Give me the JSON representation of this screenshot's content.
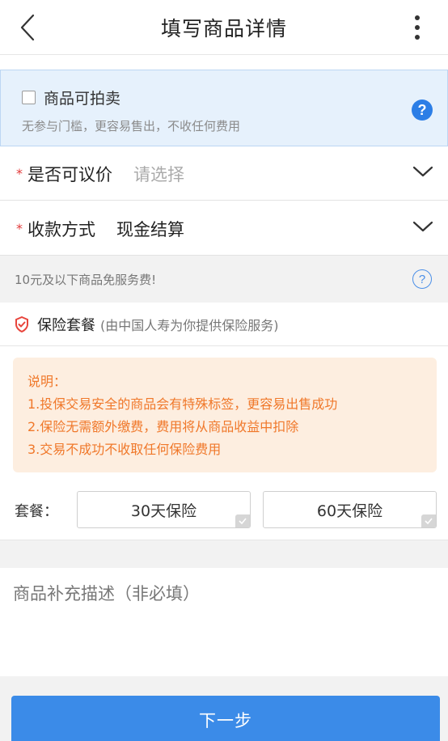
{
  "header": {
    "title": "填写商品详情",
    "back_icon": "back-chevron-icon",
    "more_icon": "more-vertical-icon"
  },
  "auction": {
    "checked": false,
    "label": "商品可拍卖",
    "description": "无参与门槛，更容易售出，不收任何费用",
    "help_icon": "help-circle-icon"
  },
  "negotiable": {
    "required_mark": "*",
    "label": "是否可议价",
    "value": "请选择"
  },
  "payment": {
    "required_mark": "*",
    "label": "收款方式",
    "value": "现金结算"
  },
  "fee_notice": {
    "text": "10元及以下商品免服务费!",
    "help_icon": "help-circle-outline-icon"
  },
  "insurance": {
    "title": "保险套餐",
    "subtitle": "(由中国人寿为你提供保险服务)",
    "notice_lines": [
      "说明：",
      "1.投保交易安全的商品会有特殊标签，更容易出售成功",
      "2.保险无需额外缴费，费用将从商品收益中扣除",
      "3.交易不成功不收取任何保险费用"
    ],
    "plan_label": "套餐：",
    "plans": [
      "30天保险",
      "60天保险"
    ]
  },
  "description": {
    "placeholder": "商品补充描述（非必填）"
  },
  "next_button": {
    "label": "下一步"
  },
  "colors": {
    "accent": "#3b8be8",
    "required": "#e23a3a",
    "notice_text": "#f0782a",
    "notice_bg": "#fdeee0",
    "auction_bg": "#e6f1fc"
  }
}
